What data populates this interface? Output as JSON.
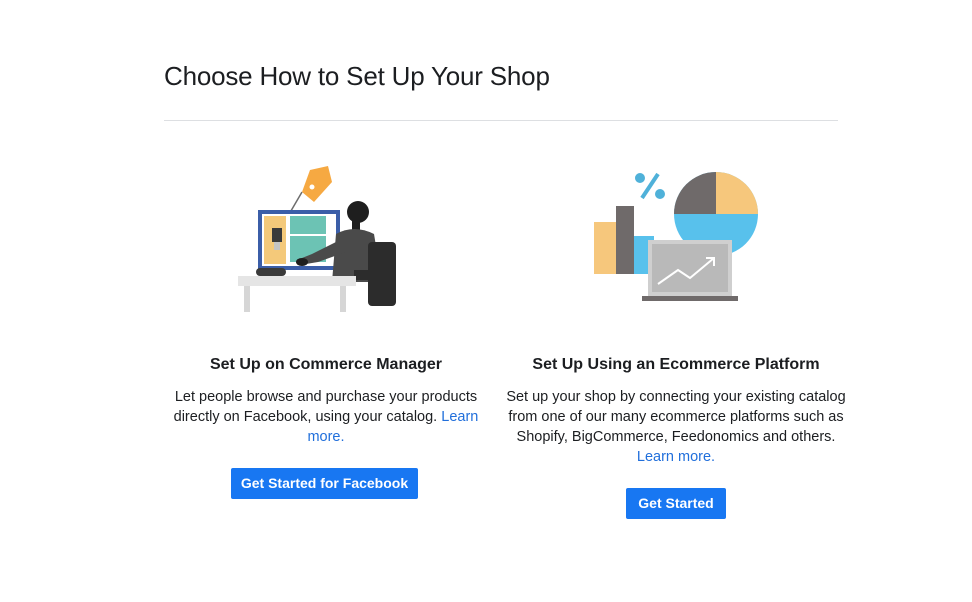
{
  "page": {
    "title": "Choose How to Set Up Your Shop"
  },
  "options": [
    {
      "heading": "Set Up on Commerce Manager",
      "description": "Let people browse and purchase your products directly on Facebook, using your catalog.",
      "link_label": "Learn more.",
      "button_label": "Get Started for Facebook",
      "illustration": "person-at-computer-with-price-tag"
    },
    {
      "heading": "Set Up Using an Ecommerce Platform",
      "description": "Set up your shop by connecting your existing catalog from one of our many ecommerce platforms such as Shopify, BigCommerce, Feedonomics and others.",
      "link_label": "Learn more.",
      "button_label": "Get Started",
      "illustration": "charts-and-laptop"
    }
  ],
  "colors": {
    "primary_button": "#1877f2",
    "link": "#216fdb",
    "text": "#1c1e21",
    "divider": "#dddfe2"
  }
}
